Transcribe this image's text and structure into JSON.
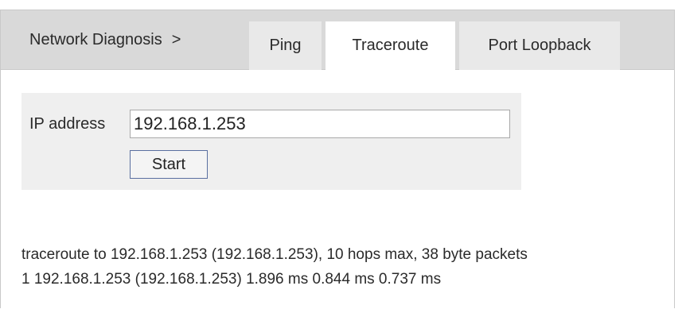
{
  "nav": {
    "section": "Network Diagnosis",
    "separator": ">",
    "tabs": [
      {
        "label": "Ping",
        "active": false
      },
      {
        "label": "Traceroute",
        "active": true
      },
      {
        "label": "Port Loopback",
        "active": false
      }
    ]
  },
  "form": {
    "ip_label": "IP address",
    "ip_value": "192.168.1.253",
    "start_label": "Start"
  },
  "output": {
    "lines": [
      "traceroute to 192.168.1.253 (192.168.1.253), 10 hops max, 38 byte packets",
      "1 192.168.1.253 (192.168.1.253) 1.896 ms 0.844 ms 0.737 ms"
    ]
  },
  "colors": {
    "tabbar_bg": "#d9d9d9",
    "inactive_tab_bg": "#e9e9e9",
    "active_tab_bg": "#ffffff",
    "form_bg": "#efefef",
    "button_border": "#5a6fa0"
  }
}
